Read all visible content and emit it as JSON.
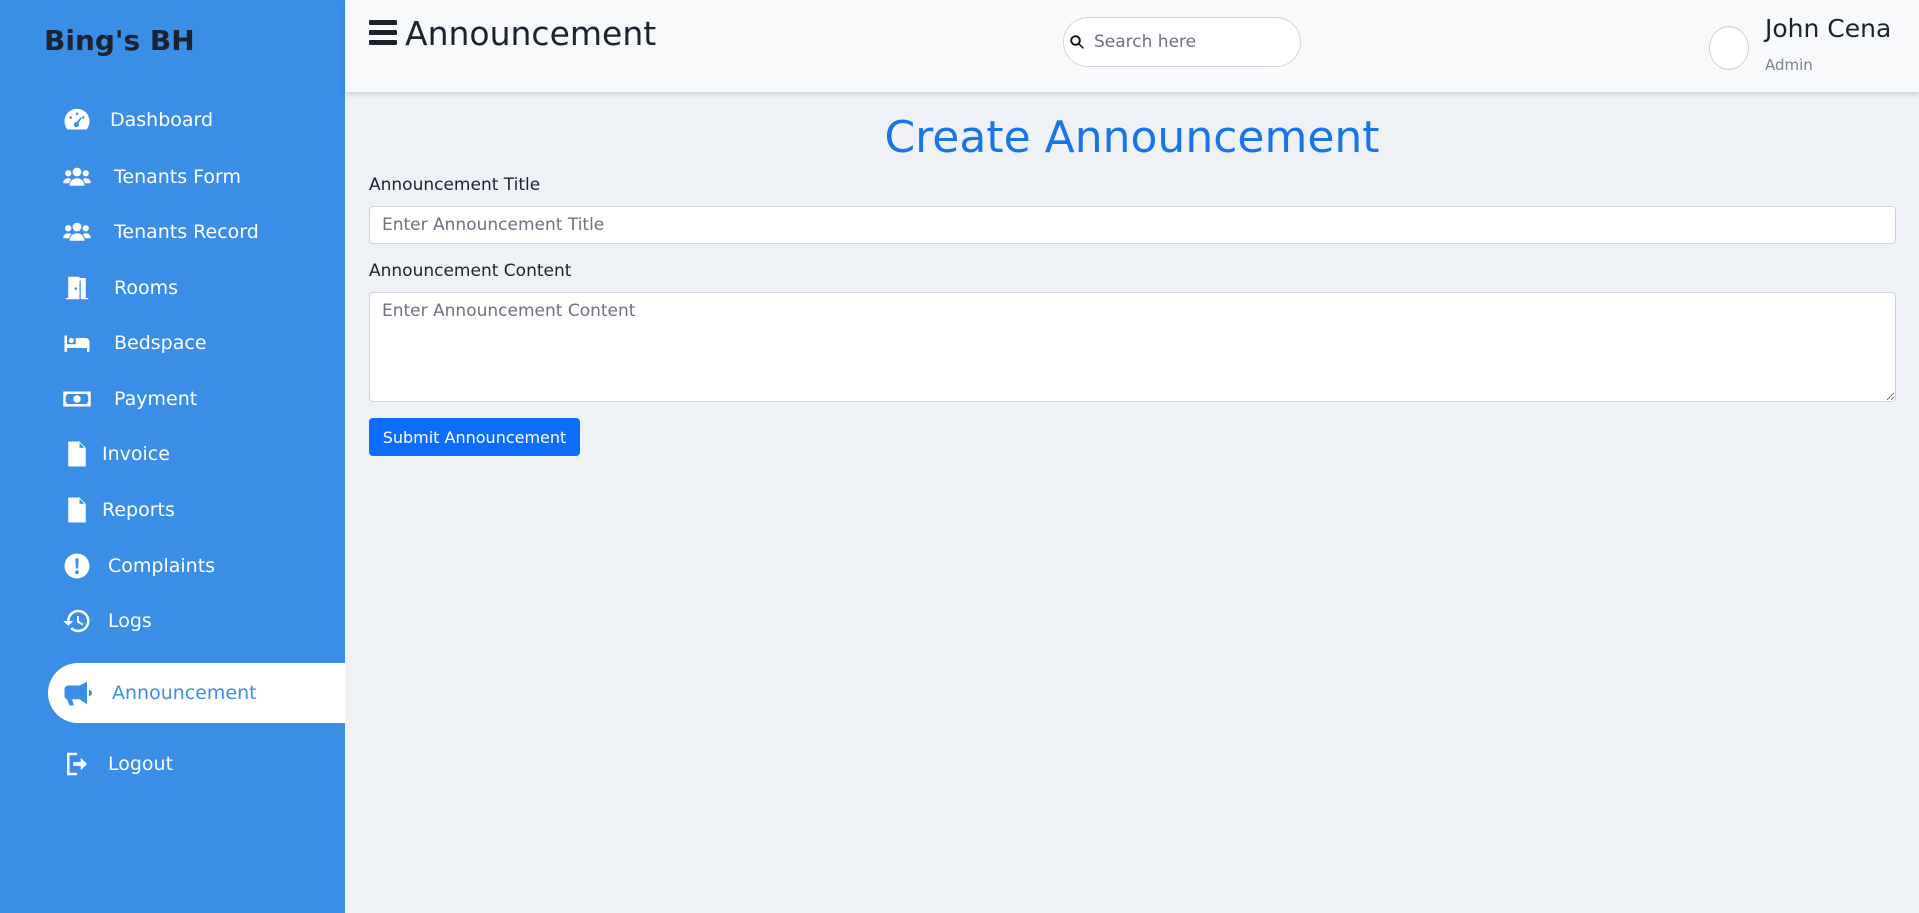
{
  "sidebar": {
    "brand": "Bing's BH",
    "items": [
      {
        "label": "Dashboard",
        "icon": "dashboard-icon"
      },
      {
        "label": "Tenants Form",
        "icon": "users-icon"
      },
      {
        "label": "Tenants Record",
        "icon": "users-icon"
      },
      {
        "label": "Rooms",
        "icon": "door-icon"
      },
      {
        "label": "Bedspace",
        "icon": "bed-icon"
      },
      {
        "label": "Payment",
        "icon": "money-icon"
      },
      {
        "label": "Invoice",
        "icon": "invoice-icon"
      },
      {
        "label": "Reports",
        "icon": "report-icon"
      },
      {
        "label": "Complaints",
        "icon": "exclamation-icon"
      },
      {
        "label": "Logs",
        "icon": "history-icon"
      },
      {
        "label": "Announcement",
        "icon": "megaphone-icon",
        "active": true
      },
      {
        "label": "Logout",
        "icon": "logout-icon"
      }
    ]
  },
  "header": {
    "title": "Announcement",
    "search_placeholder": "Search here",
    "user_name": "John Cena",
    "user_role": "Admin"
  },
  "main": {
    "heading": "Create Announcement",
    "title_label": "Announcement Title",
    "title_placeholder": "Enter Announcement Title",
    "content_label": "Announcement Content",
    "content_placeholder": "Enter Announcement Content",
    "submit_label": "Submit Announcement"
  },
  "colors": {
    "sidebar_bg": "#3b8ee6",
    "accent": "#1a74e8",
    "button": "#0d6efd",
    "page_bg": "#eef2f7"
  }
}
